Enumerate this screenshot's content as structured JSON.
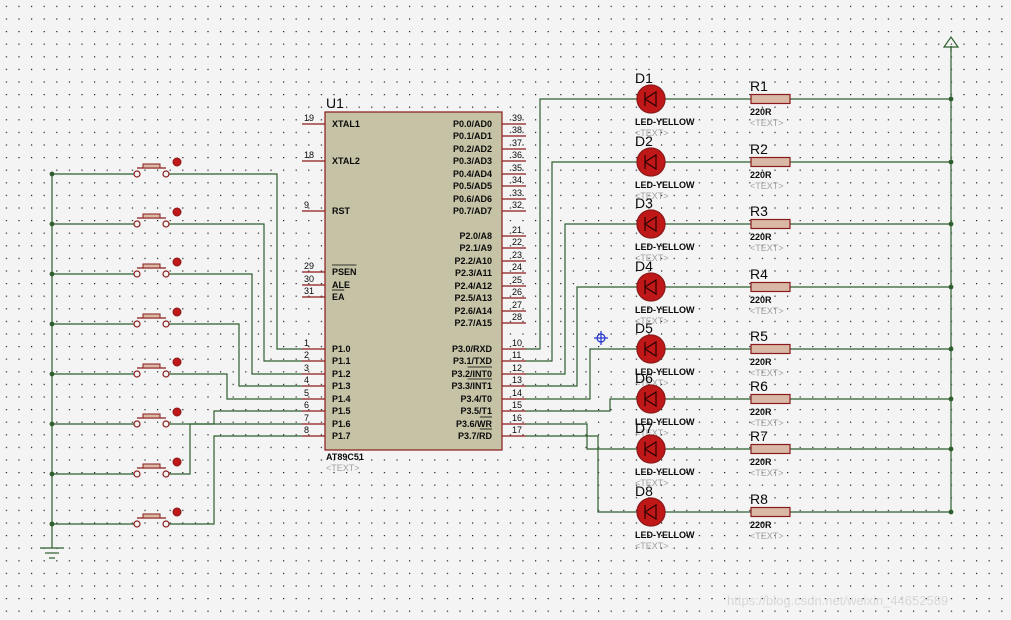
{
  "colors": {
    "background": "#f4f4f4",
    "grid_dot": "#1a1a1a",
    "wire": "#2f5f2f",
    "component": "#8b1a1a",
    "chip_fill": "#c5c2a6",
    "resistor_fill": "#d9b8a6",
    "led_fill": "#c01818",
    "text": "#0a0a0a",
    "placeholder": "#a0a0a0",
    "cursor": "#2233cc"
  },
  "chip": {
    "ref": "U1",
    "part": "AT89C51",
    "placeholder": "<TEXT>",
    "left_pins": [
      {
        "num": "19",
        "label": "XTAL1"
      },
      {
        "num": "18",
        "label": "XTAL2"
      },
      {
        "num": "9",
        "label": "RST"
      },
      {
        "num": "29",
        "label": "PSEN"
      },
      {
        "num": "30",
        "label": "ALE"
      },
      {
        "num": "31",
        "label": "EA"
      },
      {
        "num": "1",
        "label": "P1.0"
      },
      {
        "num": "2",
        "label": "P1.1"
      },
      {
        "num": "3",
        "label": "P1.2"
      },
      {
        "num": "4",
        "label": "P1.3"
      },
      {
        "num": "5",
        "label": "P1.4"
      },
      {
        "num": "6",
        "label": "P1.5"
      },
      {
        "num": "7",
        "label": "P1.6"
      },
      {
        "num": "8",
        "label": "P1.7"
      }
    ],
    "right_pins": [
      {
        "num": "39",
        "label": "P0.0/AD0"
      },
      {
        "num": "38",
        "label": "P0.1/AD1"
      },
      {
        "num": "37",
        "label": "P0.2/AD2"
      },
      {
        "num": "36",
        "label": "P0.3/AD3"
      },
      {
        "num": "35",
        "label": "P0.4/AD4"
      },
      {
        "num": "34",
        "label": "P0.5/AD5"
      },
      {
        "num": "33",
        "label": "P0.6/AD6"
      },
      {
        "num": "32",
        "label": "P0.7/AD7"
      },
      {
        "num": "21",
        "label": "P2.0/A8"
      },
      {
        "num": "22",
        "label": "P2.1/A9"
      },
      {
        "num": "23",
        "label": "P2.2/A10"
      },
      {
        "num": "24",
        "label": "P2.3/A11"
      },
      {
        "num": "25",
        "label": "P2.4/A12"
      },
      {
        "num": "26",
        "label": "P2.5/A13"
      },
      {
        "num": "27",
        "label": "P2.6/A14"
      },
      {
        "num": "28",
        "label": "P2.7/A15"
      },
      {
        "num": "10",
        "label": "P3.0/RXD"
      },
      {
        "num": "11",
        "label": "P3.1/TXD"
      },
      {
        "num": "12",
        "label": "P3.2/INT0"
      },
      {
        "num": "13",
        "label": "P3.3/INT1"
      },
      {
        "num": "14",
        "label": "P3.4/T0"
      },
      {
        "num": "15",
        "label": "P3.5/T1"
      },
      {
        "num": "16",
        "label": "P3.6/WR"
      },
      {
        "num": "17",
        "label": "P3.7/RD"
      }
    ]
  },
  "leds": [
    {
      "ref": "D1",
      "value": "LED-YELLOW",
      "placeholder": "<TEXT>"
    },
    {
      "ref": "D2",
      "value": "LED-YELLOW",
      "placeholder": "<TEXT>"
    },
    {
      "ref": "D3",
      "value": "LED-YELLOW",
      "placeholder": "<TEXT>"
    },
    {
      "ref": "D4",
      "value": "LED-YELLOW",
      "placeholder": "<TEXT>"
    },
    {
      "ref": "D5",
      "value": "LED-YELLOW",
      "placeholder": "<TEXT>"
    },
    {
      "ref": "D6",
      "value": "LED-YELLOW",
      "placeholder": "<TEXT>"
    },
    {
      "ref": "D7",
      "value": "LED-YELLOW",
      "placeholder": "<TEXT>"
    },
    {
      "ref": "D8",
      "value": "LED-YELLOW",
      "placeholder": "<TEXT>"
    }
  ],
  "resistors": [
    {
      "ref": "R1",
      "value": "220R",
      "placeholder": "<TEXT>"
    },
    {
      "ref": "R2",
      "value": "220R",
      "placeholder": "<TEXT>"
    },
    {
      "ref": "R3",
      "value": "220R",
      "placeholder": "<TEXT>"
    },
    {
      "ref": "R4",
      "value": "220R",
      "placeholder": "<TEXT>"
    },
    {
      "ref": "R5",
      "value": "220R",
      "placeholder": "<TEXT>"
    },
    {
      "ref": "R6",
      "value": "220R",
      "placeholder": "<TEXT>"
    },
    {
      "ref": "R7",
      "value": "220R",
      "placeholder": "<TEXT>"
    },
    {
      "ref": "R8",
      "value": "220R",
      "placeholder": "<TEXT>"
    }
  ],
  "buttons": [
    {
      "kind": "pushbutton"
    },
    {
      "kind": "pushbutton"
    },
    {
      "kind": "pushbutton"
    },
    {
      "kind": "pushbutton"
    },
    {
      "kind": "pushbutton"
    },
    {
      "kind": "pushbutton"
    },
    {
      "kind": "pushbutton"
    },
    {
      "kind": "pushbutton"
    }
  ],
  "power_terminal": {
    "icon": "power-arrow-icon"
  },
  "ground_terminal": {
    "icon": "ground-icon"
  },
  "cursor": {
    "icon": "crosshair-cursor-icon"
  },
  "watermark": "https://blog.csdn.net/weixin_44652589"
}
